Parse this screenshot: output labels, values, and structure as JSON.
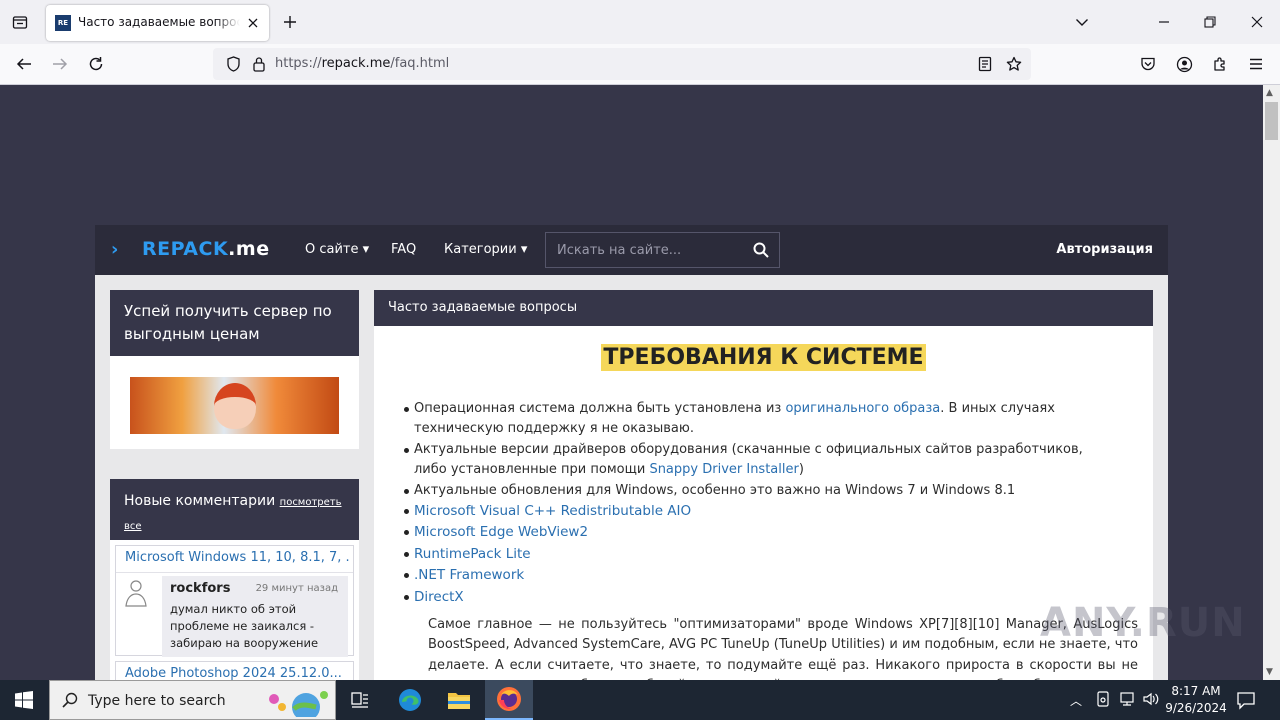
{
  "browser": {
    "tab_title": "Часто задаваемые вопросы » RePack.me",
    "url_prefix": "https://",
    "url_domain": "repack.me",
    "url_path": "/faq.html"
  },
  "site": {
    "logo_main": "REPACK",
    "logo_suffix": ".me",
    "nav": {
      "about": "О сайте ▾",
      "faq": "FAQ",
      "categories": "Категории ▾"
    },
    "search_placeholder": "Искать на сайте...",
    "login": "Авторизация"
  },
  "sidebar": {
    "promo_title": "Успей получить сервер по выгодным ценам",
    "comments_title": "Новые комментарии",
    "comments_more": "посмотреть все",
    "comments": [
      {
        "post": "Microsoft Windows 11, 10, 8.1, 7, ...",
        "user": "rockfors",
        "time": "29 минут назад",
        "text": "думал никто об этой проблеме не заикался - забираю на вооружение"
      },
      {
        "post": "Adobe Photoshop 2024 25.12.0..."
      }
    ]
  },
  "main": {
    "panel_title": "Часто задаваемые вопросы",
    "heading": "ТРЕБОВАНИЯ К СИСТЕМЕ",
    "req1_a": "Операционная система должна быть установлена из ",
    "req1_link": "оригинального образа",
    "req1_b": ". В иных случаях техническую поддержку я не оказываю.",
    "req2_a": "Актуальные версии драйверов оборудования (скачанные с официальных сайтов разработчиков, либо установленные при помощи ",
    "req2_link": "Snappy Driver Installer",
    "req2_b": ")",
    "req3": "Актуальные обновления для Windows, особенно это важно на Windows 7 и Windows 8.1",
    "links": [
      "Microsoft Visual C++ Redistributable AIO",
      "Microsoft Edge WebView2",
      "RuntimePack Lite",
      ".NET Framework",
      "DirectX"
    ],
    "paragraph": "Самое главное — не пользуйтесь \"оптимизаторами\" вроде Windows XP[7][8][10] Manager, AusLogics BoostSpeed, Advanced SystemCare, AVG PC TuneUp (TuneUp Utilities) и им подобным, если не знаете, что делаете. А если считаете, что знаете, то подумайте ещё раз. Никакого прироста в скорости вы не получите, но зато проблем с работой и установкой программ запросто можете себе добавить."
  },
  "watermark": "ANY.RUN",
  "taskbar": {
    "search_placeholder": "Type here to search",
    "time": "8:17 AM",
    "date": "9/26/2024"
  }
}
